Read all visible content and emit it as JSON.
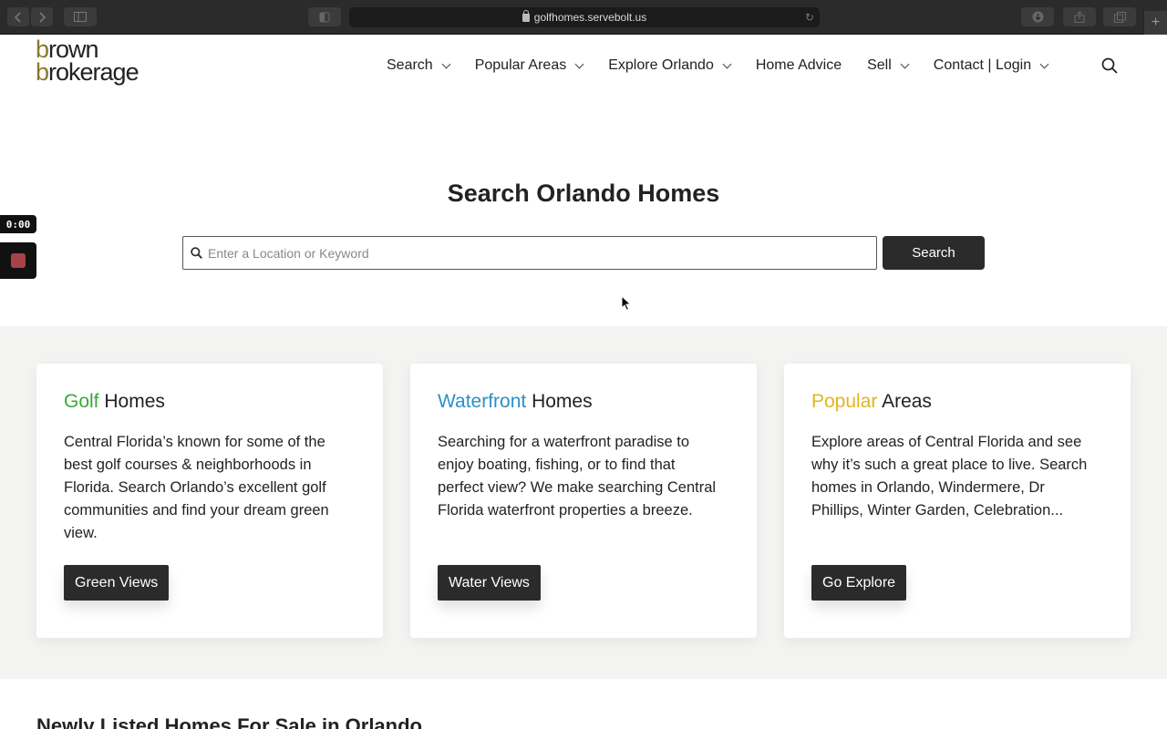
{
  "browser": {
    "url": "golfhomes.servebolt.us",
    "new_tab_symbol": "+"
  },
  "logo": {
    "line1_first": "b",
    "line1_rest": "rown",
    "line2_first": "b",
    "line2_rest": "rokerage"
  },
  "nav": {
    "items": [
      {
        "label": "Search",
        "dropdown": true
      },
      {
        "label": "Popular Areas",
        "dropdown": true
      },
      {
        "label": "Explore Orlando",
        "dropdown": true
      },
      {
        "label": "Home Advice",
        "dropdown": false
      },
      {
        "label": "Sell",
        "dropdown": true
      },
      {
        "label": "Contact | Login",
        "dropdown": true
      }
    ]
  },
  "hero": {
    "title": "Search Orlando Homes",
    "search_placeholder": "Enter a Location or Keyword",
    "search_button": "Search"
  },
  "recorder": {
    "time": "0:00"
  },
  "cards": [
    {
      "accent": "Golf",
      "title_rest": " Homes",
      "accent_color": "#3aa83a",
      "body": "Central Florida’s known for some of the best golf courses & neighborhoods in Florida. Search Orlando’s excellent golf communities and find your dream green view.",
      "button": "Green Views"
    },
    {
      "accent": "Waterfront",
      "title_rest": " Homes",
      "accent_color": "#2f8fc7",
      "body": "Searching for a waterfront paradise to enjoy boating, fishing, or to find that perfect view? We make searching Central Florida waterfront properties a breeze.",
      "button": "Water Views"
    },
    {
      "accent": "Popular",
      "title_rest": " Areas",
      "accent_color": "#e3b521",
      "body": "Explore areas of Central Florida and see why it’s such a great place to live. Search homes in Orlando, Windermere, Dr Phillips, Winter Garden, Celebration...",
      "button": "Go Explore"
    }
  ],
  "section_heading": "Newly Listed Homes For Sale in Orlando"
}
